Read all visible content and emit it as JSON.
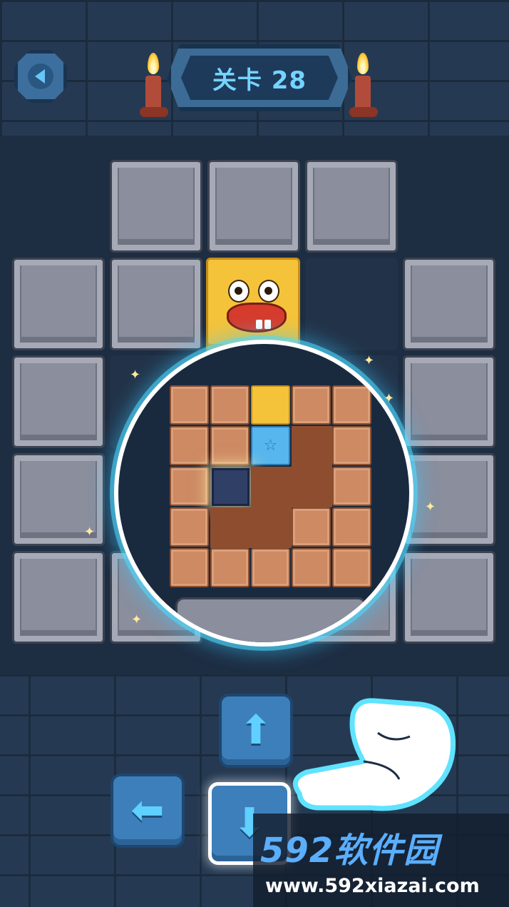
{
  "header": {
    "level_title": "关卡 28"
  },
  "board": {
    "columns": 5,
    "rows": 5,
    "cells": [
      [
        "empty",
        "stone",
        "stone",
        "stone",
        "empty"
      ],
      [
        "stone",
        "stone",
        "character",
        "slot",
        "stone"
      ],
      [
        "stone",
        "slot",
        "slot",
        "slot",
        "stone"
      ],
      [
        "stone",
        "slot",
        "slot",
        "slot",
        "stone"
      ],
      [
        "stone",
        "stone",
        "slot",
        "stone",
        "stone"
      ]
    ]
  },
  "preview": {
    "grid": [
      [
        "tile",
        "tile",
        "character",
        "tile",
        "tile"
      ],
      [
        "tile",
        "tile",
        "ice-star",
        "floor",
        "tile"
      ],
      [
        "tile",
        "hole",
        "floor",
        "floor",
        "tile"
      ],
      [
        "tile",
        "floor",
        "floor",
        "tile",
        "tile"
      ],
      [
        "tile",
        "tile",
        "tile",
        "tile",
        "tile"
      ]
    ]
  },
  "controls": {
    "up": "up-arrow-icon",
    "left": "left-arrow-icon",
    "down": "down-arrow-icon",
    "active": "down"
  },
  "watermark": {
    "title": "592软件园",
    "url": "www.592xiazai.com"
  },
  "colors": {
    "accent": "#5fd0ff",
    "title_text": "#74d3ff",
    "character": "#f5c33a",
    "glow": "#50dcff"
  }
}
